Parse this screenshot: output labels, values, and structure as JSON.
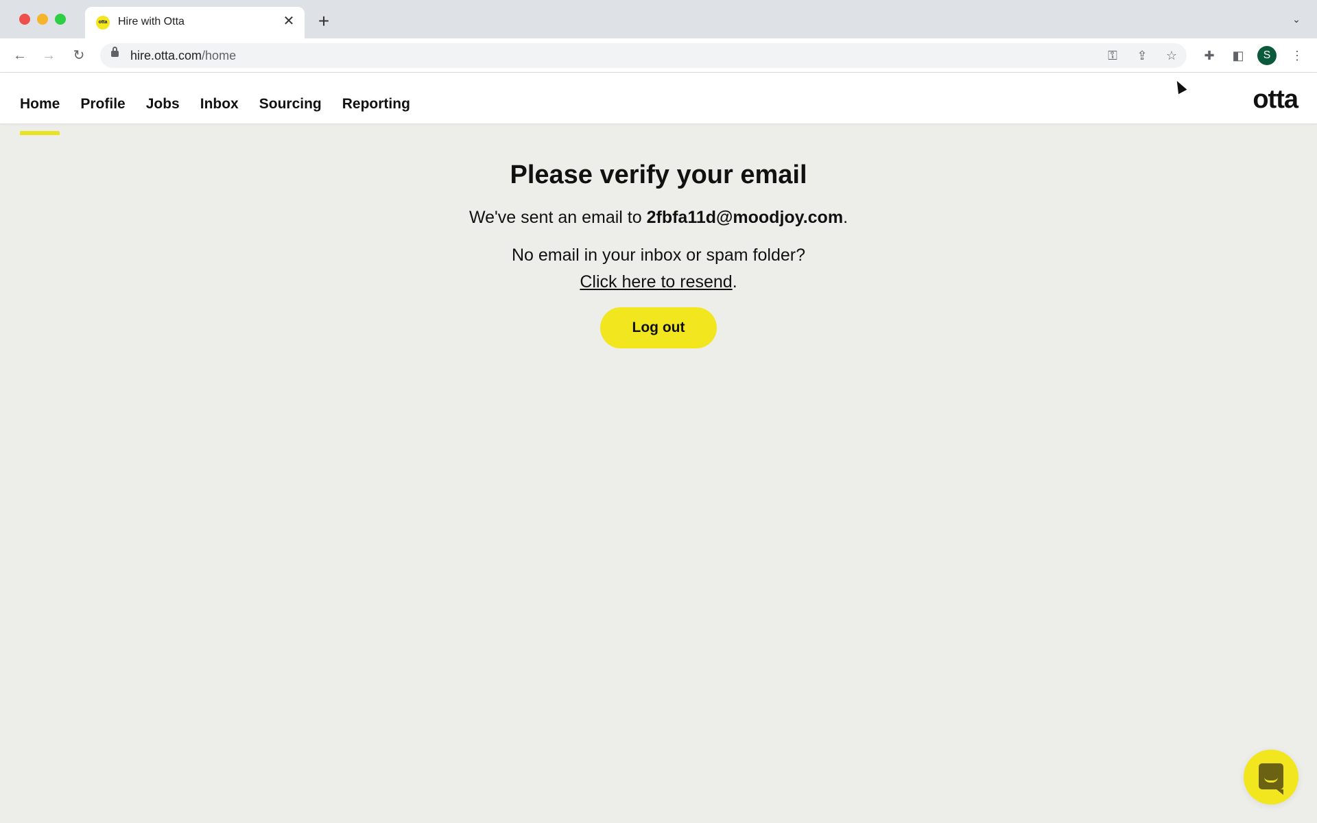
{
  "browser": {
    "tab": {
      "title": "Hire with Otta",
      "favicon_text": "otta"
    },
    "url": {
      "host": "hire.otta.com",
      "path": "/home"
    },
    "profile_initial": "S",
    "icons": {
      "close": "✕",
      "new_tab": "+",
      "tab_dropdown": "⌄",
      "back": "←",
      "forward": "→",
      "reload": "↻",
      "key": "⚿",
      "share": "⇪",
      "star": "☆",
      "extensions": "✚",
      "sidepanel": "◧",
      "menu": "⋮"
    }
  },
  "app": {
    "logo": "otta",
    "nav": [
      {
        "label": "Home",
        "active": true
      },
      {
        "label": "Profile",
        "active": false
      },
      {
        "label": "Jobs",
        "active": false
      },
      {
        "label": "Inbox",
        "active": false
      },
      {
        "label": "Sourcing",
        "active": false
      },
      {
        "label": "Reporting",
        "active": false
      }
    ]
  },
  "verify": {
    "heading": "Please verify your email",
    "sent_prefix": "We've sent an email to ",
    "email": "2fbfa11d@moodjoy.com",
    "sent_suffix": ".",
    "no_email": "No email in your inbox or spam folder?",
    "resend_link": "Click here to resend",
    "resend_suffix": ".",
    "logout_label": "Log out"
  },
  "colors": {
    "brand_yellow": "#f2e61e",
    "background": "#ededea",
    "text": "#111111"
  }
}
